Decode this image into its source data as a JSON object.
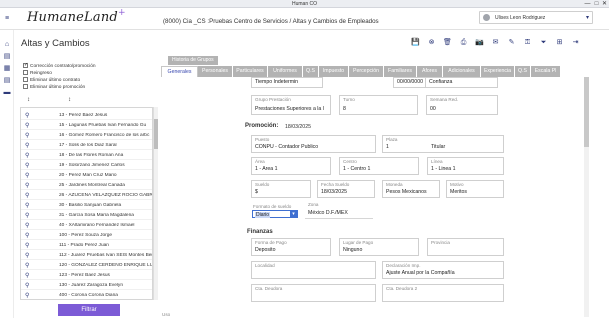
{
  "window": {
    "title": "Human CO",
    "controls": [
      "—",
      "□",
      "✕"
    ]
  },
  "header": {
    "logo": "HumaneLand",
    "logo_plus": "+",
    "breadcrumb": "(8000) Cia _CS :Pruebas Centro de Servicios /  Altas y  Cambios de Empleados",
    "user_name": "Ulises Leon Rodriguez",
    "user_caret": "▾"
  },
  "sidebar": {
    "icons": [
      "hamburger-icon",
      "home-icon",
      "document-icon",
      "calendar-icon",
      "document-icon",
      "briefcase-icon"
    ],
    "glyphs": [
      "≡",
      "⌂",
      "▤",
      "▦",
      "▤",
      "▬"
    ]
  },
  "page": {
    "title": "Altas y Cambios"
  },
  "toolbar": {
    "icons": [
      "save-icon",
      "cancel-icon",
      "delete-icon",
      "print-icon",
      "camera-icon",
      "mail-icon",
      "sign-icon",
      "key-icon",
      "filter-icon",
      "grid-icon",
      "exit-icon"
    ],
    "glyphs": [
      "💾",
      "⊗",
      "🗑",
      "⎙",
      "📷",
      "✉",
      "✎",
      "⚿",
      "⏷",
      "⊞",
      "⇥"
    ]
  },
  "options": [
    {
      "label": "Corrección contrato/promoción",
      "checked": true
    },
    {
      "label": "Reingreso",
      "checked": false
    },
    {
      "label": "Eliminar último contrato",
      "checked": false
    },
    {
      "label": "Eliminar último promoción",
      "checked": false
    }
  ],
  "list_arrows": [
    "↕",
    "↕"
  ],
  "employees": [
    "13 - Perez  Baez  Jesus",
    "15 - Lagunas Pruebas Ivan Fernando Gu",
    "16 - Gómez Romero Francisco de los arbc",
    "17 - Solis de los Diaz Saral",
    "18 - De las Flores Roman Ana",
    "19 - Solorzano Jimenez Carlos",
    "20 - Perez Man Cruz Mario",
    "25 - Jardines Montreal Canada",
    "26 - AZUCENA VELAZQUEZ ROCIO GABRIE",
    "30 - Basilio Sanjuan Gabriela",
    "31 - García Sosa María Magdalena",
    "40 - XAltamirano Fernandez Ismael",
    "100 - Perez Souza Jorge",
    "111 - Prado Perez Juan",
    "112 - Juarez Pruebas Ivan SEIS Montes Ben",
    "120 - GONZALEZ CERDEÑO ENRIQUE LUIS",
    "123 - Perez Baez Jesus",
    "130 - Juárez Zaragoza Evelyn",
    "400 - Corona Corona Diana"
  ],
  "filter_button": "Filtrar",
  "tabs": {
    "top": "Historia de Grupos",
    "items": [
      "Generales",
      "Personales",
      "Particulares",
      "Uniformes",
      "Q.S",
      "Impuesto",
      "Percepción",
      "Familiares",
      "Afores",
      "Adicionales",
      "Experiencia",
      "Q.S",
      "Escala Pl"
    ],
    "active_index": 0
  },
  "form": {
    "top_values": [
      "Tiempo Indetermin",
      "00/00/0000",
      "Confianza"
    ],
    "grupo_prestacion": {
      "label": "Grupo Prestación",
      "value": "Prestaciones Superiores a la l"
    },
    "turno": {
      "label": "Turno",
      "value": "8"
    },
    "semana_red": {
      "label": "Semana Red.",
      "value": "00"
    },
    "promocion": {
      "label": "Promoción:",
      "date": "18/03/2025"
    },
    "puesto": {
      "label": "Puesto",
      "value": "CONPU - Contador Publico"
    },
    "plaza": {
      "label": "Plaza",
      "value": "1",
      "extra": "Titular"
    },
    "area": {
      "label": "Área",
      "value": "1 - Area 1"
    },
    "centro": {
      "label": "Centro",
      "value": "1 - Centro 1"
    },
    "linea": {
      "label": "Línea",
      "value": "1 - Linea 1"
    },
    "sueldo": {
      "label": "Sueldo",
      "value": "$"
    },
    "fecha_sueldo": {
      "label": "Fecha Sueldo",
      "value": "18/03/2025"
    },
    "moneda": {
      "label": "Moneda",
      "value": "Pesos Mexicanos"
    },
    "motivo": {
      "label": "Motivo",
      "value": "Meritos"
    },
    "formato_sueldo": {
      "label": "Formato de sueldo",
      "value": "Diario"
    },
    "zona": {
      "label": "Zona",
      "value": "México D.F./MEX"
    },
    "finanzas": {
      "label": "Finanzas"
    },
    "forma_pago": {
      "label": "Forma de Pago",
      "value": "Deposito"
    },
    "lugar_pago": {
      "label": "Lugar de Pago",
      "value": "Ninguno"
    },
    "provincia": {
      "label": "Provincia",
      "value": ""
    },
    "localidad": {
      "label": "Localidad",
      "value": ""
    },
    "declaracion": {
      "label": "Declaración Imp.",
      "value": "Ajuste Anual por la Compañía"
    },
    "cta_deudora": {
      "label": "Cta. Deudora",
      "value": ""
    },
    "cta_deudora2": {
      "label": "Cta. Deudora 2",
      "value": ""
    },
    "bottom_label": "Uso"
  }
}
